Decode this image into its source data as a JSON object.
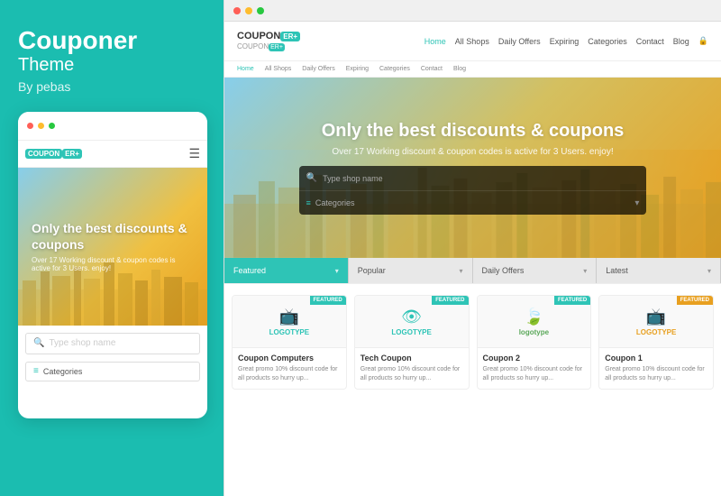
{
  "left": {
    "brand": "Couponer",
    "subtitle": "Theme",
    "author": "By pebas",
    "mobile": {
      "logo": "COUPON",
      "logo_badge": "ER+",
      "hero_title": "Only the best discounts & coupons",
      "hero_sub": "Over 17 Working discount & coupon codes is active for 3 Users. enjoy!",
      "search_placeholder": "Type shop name",
      "categories_label": "Categories"
    }
  },
  "right": {
    "logo": "COUPON",
    "logo_badge": "ER+",
    "logo_sub": "COUPON",
    "logo_sub2": "ER+",
    "nav": {
      "links": [
        "Home",
        "All Shops",
        "Daily Offers",
        "Expiring",
        "Categories",
        "Contact",
        "Blog"
      ],
      "active": "Home"
    },
    "hero": {
      "title": "Only the best discounts & coupons",
      "subtitle": "Over 17 Working discount & coupon codes is active for 3 Users. enjoy!",
      "search_placeholder": "Type shop name",
      "categories_placeholder": "Categories"
    },
    "filter_tabs": [
      {
        "label": "Featured"
      },
      {
        "label": "Popular"
      },
      {
        "label": "Daily Offers"
      },
      {
        "label": "Latest"
      }
    ],
    "cards": [
      {
        "logo_text": "LOGOTYPE",
        "logo_color": "teal",
        "logo_icon": "📺",
        "badge": "FEATURED",
        "title": "Coupon Computers",
        "desc": "Great promo 10% discount code for all products so hurry up..."
      },
      {
        "logo_text": "LOGOTYPE",
        "logo_color": "teal",
        "logo_icon": "👁",
        "badge": "FEATURED",
        "title": "Tech Coupon",
        "desc": "Great promo 10% discount code for all products so hurry up..."
      },
      {
        "logo_text": "logotype",
        "logo_color": "green",
        "logo_icon": "🍃",
        "badge": "FEATURED",
        "title": "Coupon 2",
        "desc": "Great promo 10% discount code for all products so hurry up..."
      },
      {
        "logo_text": "LOGOTYPE",
        "logo_color": "gold",
        "logo_icon": "📺",
        "badge": "FEATURED",
        "title": "Coupon 1",
        "desc": "Great promo 10% discount code for all products so hurry up..."
      }
    ]
  },
  "colors": {
    "teal": "#2ec4b6",
    "gold": "#e8a020",
    "green": "#5ba85a"
  }
}
